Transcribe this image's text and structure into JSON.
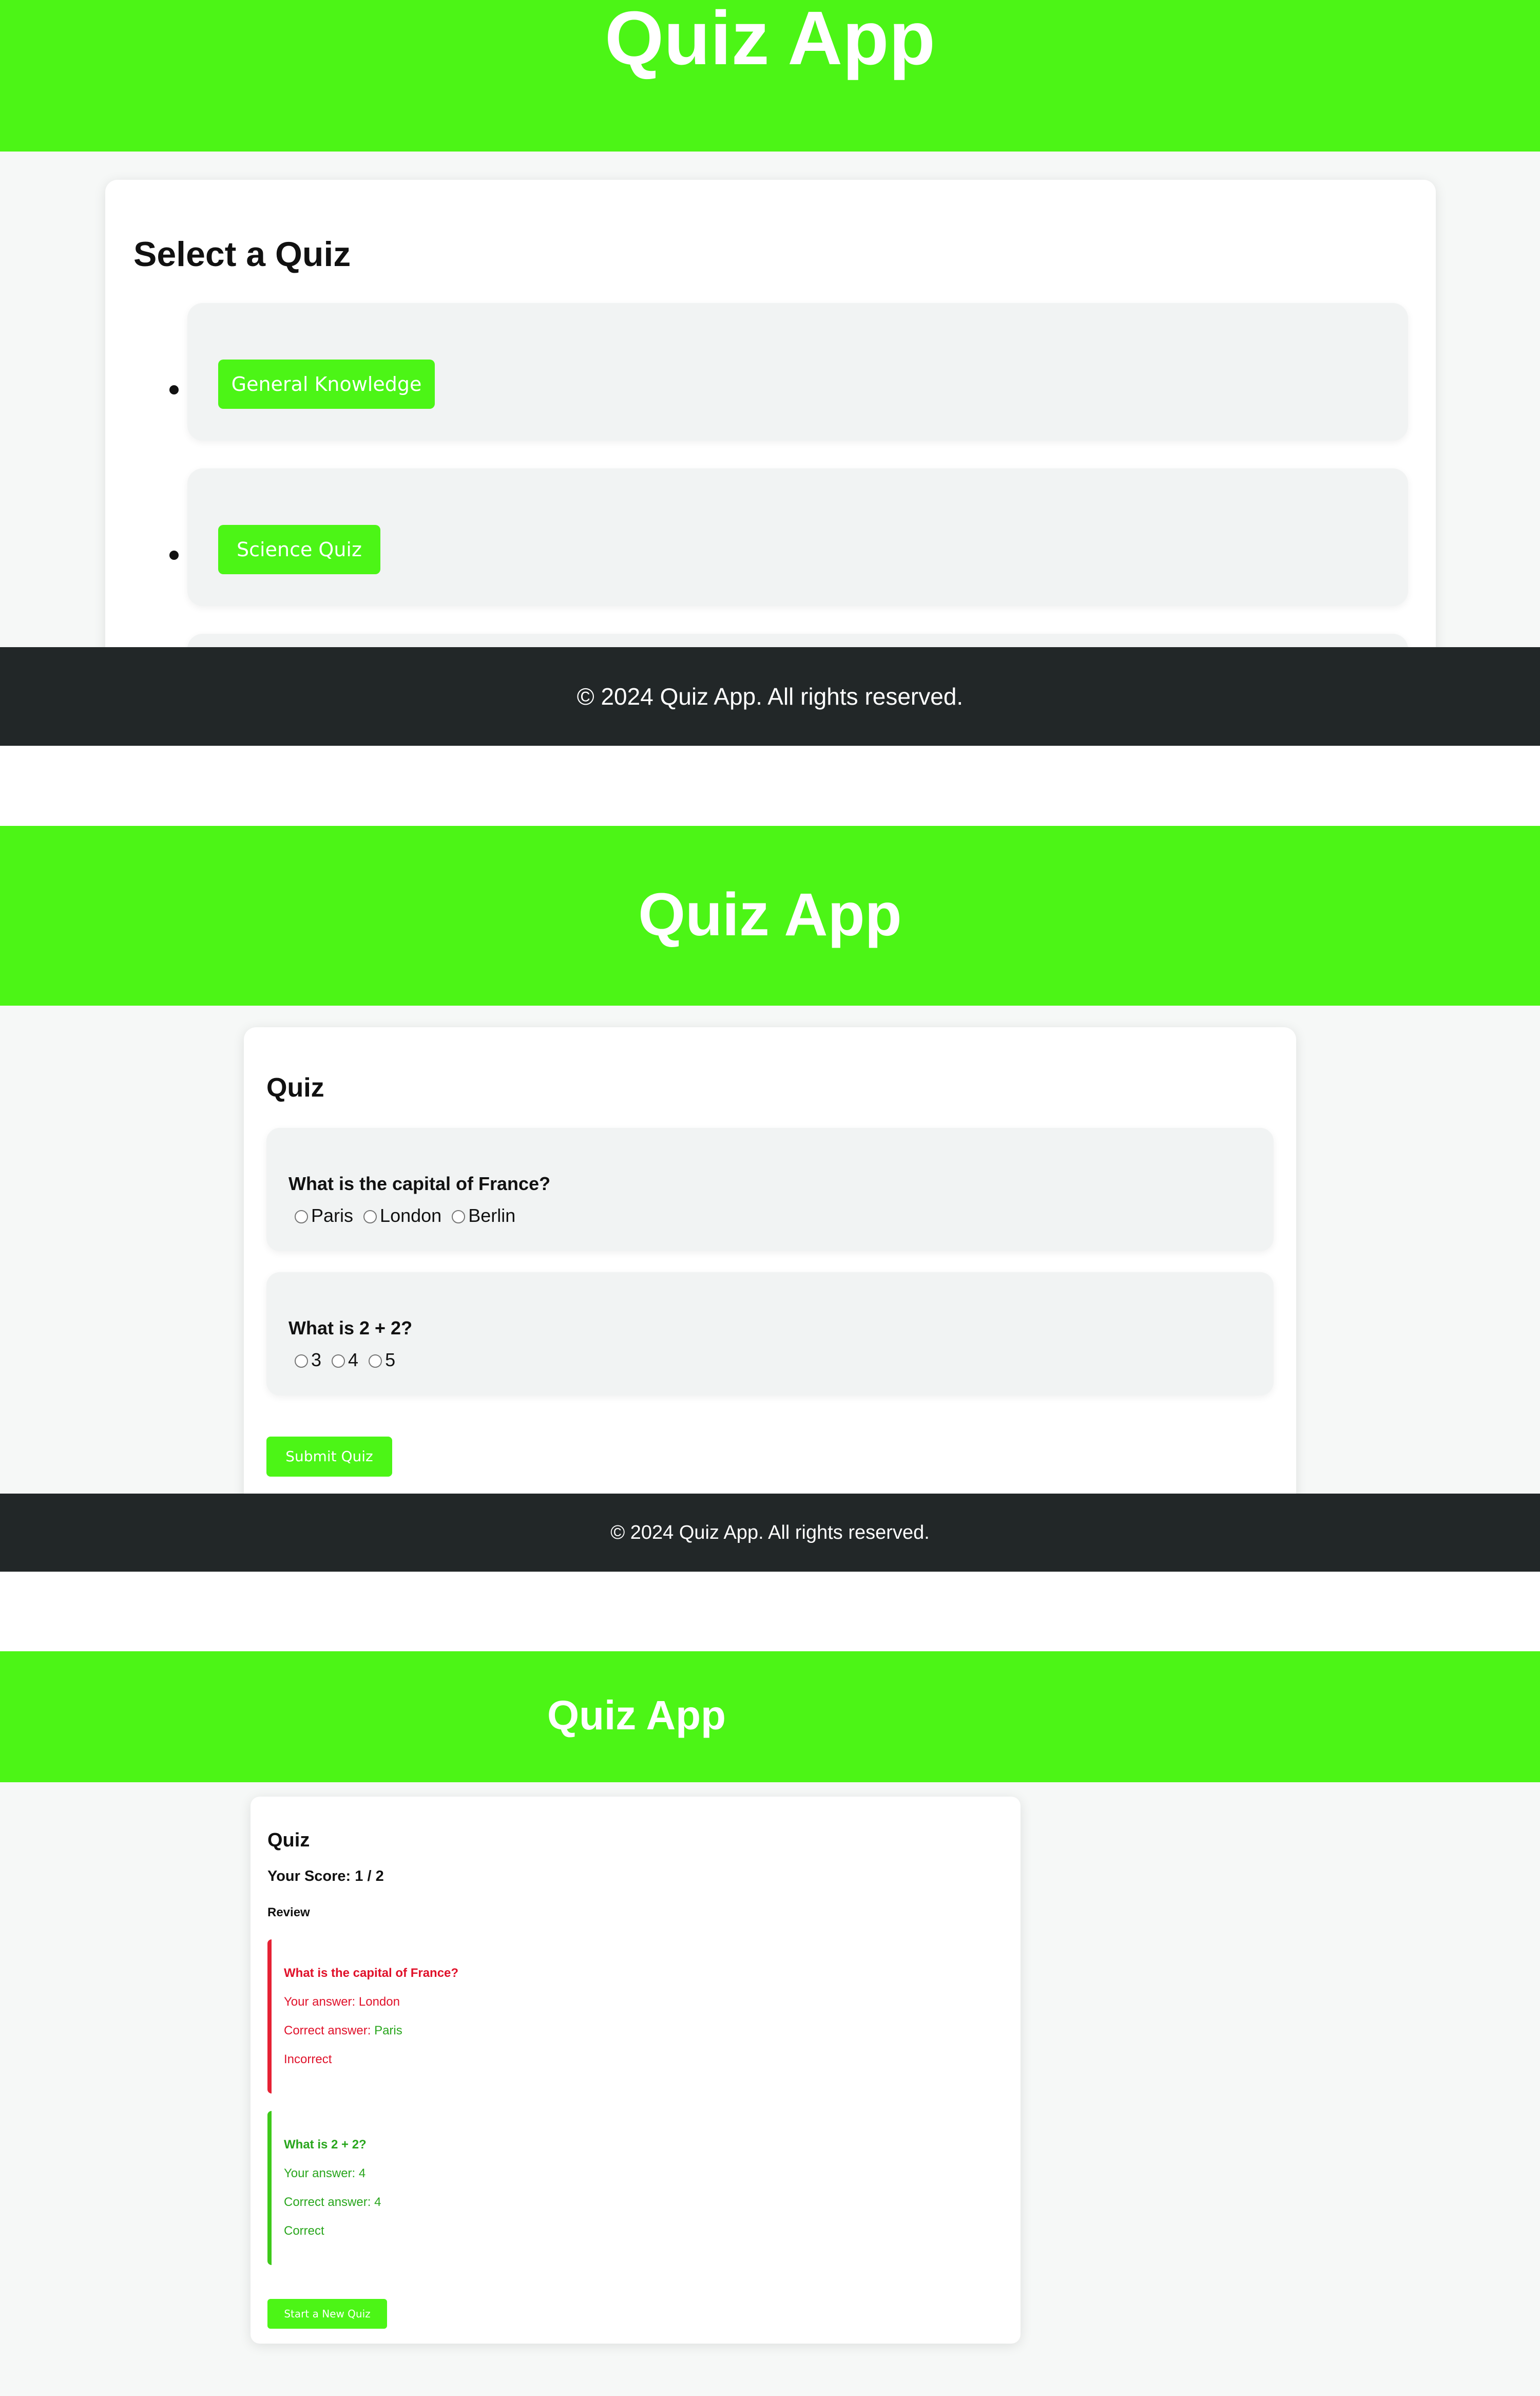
{
  "app": {
    "title": "Quiz App",
    "footer": "© 2024 Quiz App. All rights reserved."
  },
  "colors": {
    "accent": "#4cf516",
    "footer_bg": "#222728",
    "incorrect": "#e0112a",
    "correct": "#29a61d"
  },
  "select_screen": {
    "heading": "Select a Quiz",
    "quizzes": [
      {
        "label": "General Knowledge"
      },
      {
        "label": "Science Quiz"
      }
    ]
  },
  "quiz_screen": {
    "heading": "Quiz",
    "questions": [
      {
        "text": "What is the capital of France?",
        "options": [
          "Paris",
          "London",
          "Berlin"
        ]
      },
      {
        "text": "What is 2 + 2?",
        "options": [
          "3",
          "4",
          "5"
        ]
      }
    ],
    "submit_label": "Submit Quiz"
  },
  "results_screen": {
    "heading": "Quiz",
    "score_text": "Your Score: 1 / 2",
    "review_label": "Review",
    "items": [
      {
        "question": "What is the capital of France?",
        "your_answer_label": "Your answer:",
        "your_answer": "London",
        "correct_answer_label": "Correct answer:",
        "correct_answer": "Paris",
        "verdict": "Incorrect"
      },
      {
        "question": "What is 2 + 2?",
        "your_answer_label": "Your answer:",
        "your_answer": "4",
        "correct_answer_label": "Correct answer:",
        "correct_answer": "4",
        "verdict": "Correct"
      }
    ],
    "new_quiz_label": "Start a New Quiz"
  }
}
